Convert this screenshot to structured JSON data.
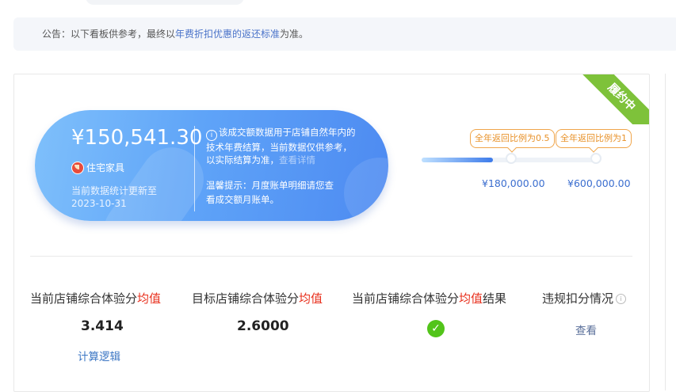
{
  "notice": {
    "prefix": "公告：以下看板供参考，最终以",
    "link": "年费折扣优惠的返还标准",
    "suffix": "为准。"
  },
  "status_ribbon": "履约中",
  "summary": {
    "amount": "¥150,541.30",
    "category": "住宅家具",
    "update_label": "当前数据统计更新至",
    "update_date": "2023-10-31",
    "info_line1": "该成交额数据用于店铺自然年内的",
    "info_line2": "技术年费结算，当前数据仅供参考，",
    "info_line3": "以实际结算为准，",
    "info_faded": "查看详情",
    "tip_line1": "温馨提示：月度账单明细请您查",
    "tip_line2": "看成交额月账单。"
  },
  "progress": {
    "filled_fraction": 0.4,
    "milestones": [
      {
        "tag": "全年返回比例为0.5",
        "value": "¥180,000.00"
      },
      {
        "tag": "全年返回比例为1",
        "value": "¥600,000.00"
      }
    ]
  },
  "metrics": {
    "col1": {
      "title_a": "当前店铺综合体验分",
      "title_b": "均值",
      "value": "3.414",
      "link": "计算逻辑"
    },
    "col2": {
      "title_a": "目标店铺综合体验分",
      "title_b": "均值",
      "value": "2.6000"
    },
    "col3": {
      "title_a": "当前店铺综合体验分",
      "title_b": "均值",
      "title_c": "结果"
    },
    "col4": {
      "title": "违规扣分情况",
      "action": "查看"
    }
  },
  "colors": {
    "accent": "#4d8af1",
    "success": "#52c41a",
    "highlight": "#e8301d",
    "ribbon": "#7ec23a",
    "tag": "#f0a54a"
  }
}
